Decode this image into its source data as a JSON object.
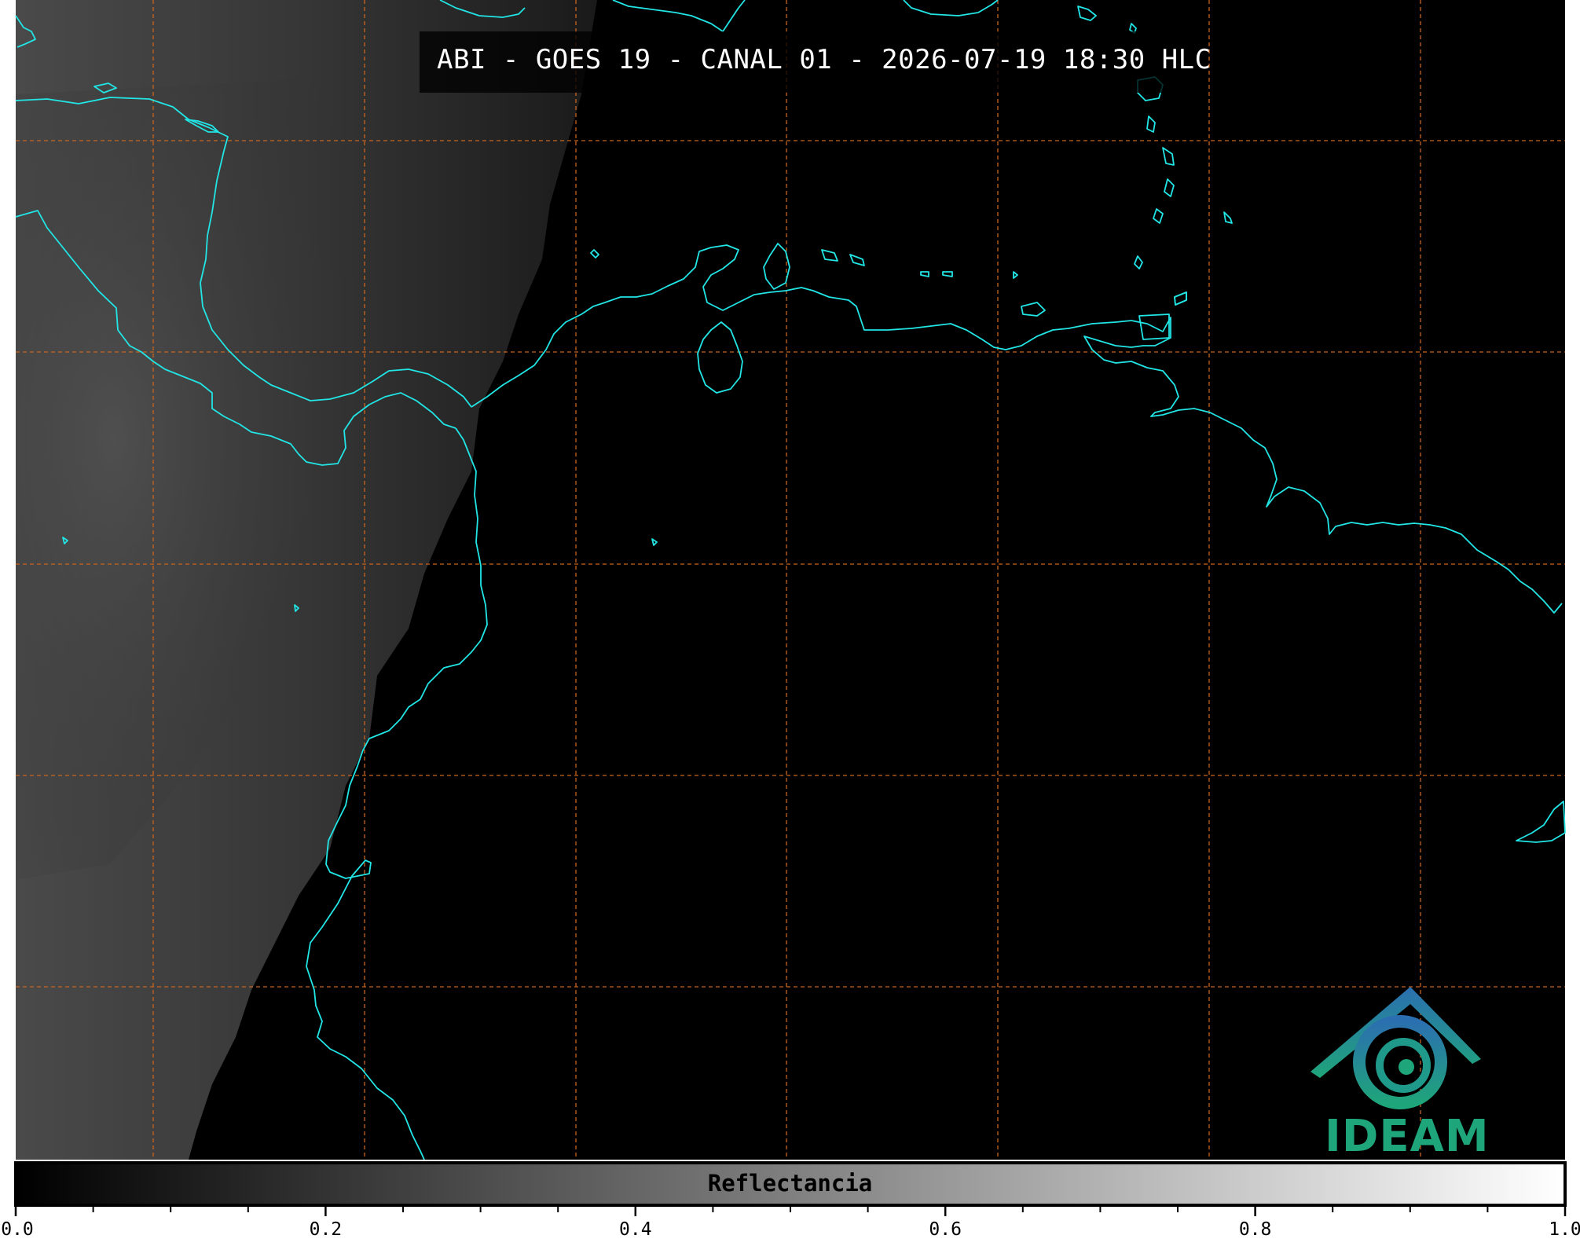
{
  "header": {
    "title": "ABI - GOES 19 - CANAL 01 - 2026-07-19 18:30 HLC"
  },
  "colorbar": {
    "label": "Reflectancia",
    "range": [
      0.0,
      1.0
    ],
    "tick_labels": [
      "0.0",
      "0.2",
      "0.4",
      "0.6",
      "0.8",
      "1.0"
    ],
    "tick_values": [
      0.0,
      0.2,
      0.4,
      0.6,
      0.8,
      1.0
    ],
    "minor_tick_step": 0.05,
    "colormap": "grayscale (black to white)"
  },
  "map": {
    "background_color": "#000000",
    "coastline_color": "#22e5e5",
    "gridline_color": "#c8641e",
    "gridline_style": "dashed"
  },
  "logo": {
    "text": "IDEAM",
    "text_color": "#1fa57a",
    "icon_top_color": "#2b6fb0",
    "icon_bottom_color": "#1fa57a"
  }
}
